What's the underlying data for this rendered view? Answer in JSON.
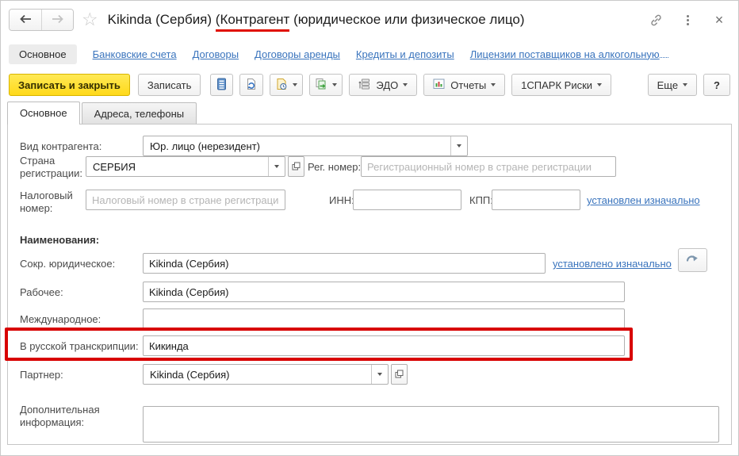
{
  "window": {
    "title_prefix": "Kikinda (Сербия) ",
    "title_underlined": "(Контрагент",
    "title_suffix": " (юридическое или физическое лицо)"
  },
  "nav": {
    "current": "Основное",
    "links": [
      "Банковские счета",
      "Договоры",
      "Договоры аренды",
      "Кредиты и депозиты",
      "Лицензии поставщиков на алкогольную"
    ]
  },
  "toolbar": {
    "save_close_label": "Записать и закрыть",
    "save_label": "Записать",
    "edo_label": "ЭДО",
    "reports_label": "Отчеты",
    "spark_label": "1СПАРК Риски",
    "more_label": "Еще",
    "help_label": "?"
  },
  "tabs": {
    "main": "Основное",
    "addresses": "Адреса, телефоны"
  },
  "form": {
    "kind_label": "Вид контрагента:",
    "kind_value": "Юр. лицо (нерезидент)",
    "country_label": "Страна регистрации:",
    "country_value": "СЕРБИЯ",
    "regnum_label": "Рег. номер:",
    "regnum_placeholder": "Регистрационный номер в стране регистрации",
    "taxnum_label": "Налоговый номер:",
    "taxnum_placeholder": "Налоговый номер в стране регистрации",
    "inn_label": "ИНН:",
    "kpp_label": "КПП:",
    "inn_link": "установлен изначально",
    "names_header": "Наименования:",
    "short_label": "Сокр. юридическое:",
    "short_value": "Kikinda (Сербия)",
    "short_link": "установлено изначально",
    "working_label": "Рабочее:",
    "working_value": "Kikinda (Сербия)",
    "intl_label": "Международное:",
    "transcription_label": "В русской транскрипции:",
    "transcription_value": "Кикинда",
    "partner_label": "Партнер:",
    "partner_value": "Kikinda (Сербия)",
    "addinfo_label": "Дополнительная информация:"
  },
  "icons": {
    "back-icon": "left arrow",
    "forward-icon": "right arrow (disabled)",
    "favorite-icon": "star outline ☆",
    "link-icon": "chain link",
    "menu-icon": "vertical kebab dots",
    "close-icon": "×",
    "dropdown-icon": "▾ caret",
    "record-list-icon": "blue record list",
    "post-document-icon": "document with blue refresh arrows",
    "history-document-icon": "document with clock",
    "copy-document-icon": "documents with green arrow",
    "edo-icon": "document stack with arrow",
    "reports-icon": "framed bar chart",
    "open-icon": "overlapping squares",
    "refill-icon": "curved slate arrow"
  },
  "colors": {
    "accent_yellow": "#ffdf1e",
    "link_blue": "#3a74bd",
    "highlight_red": "#d80000",
    "tab_gray": "#e7e7e7"
  }
}
